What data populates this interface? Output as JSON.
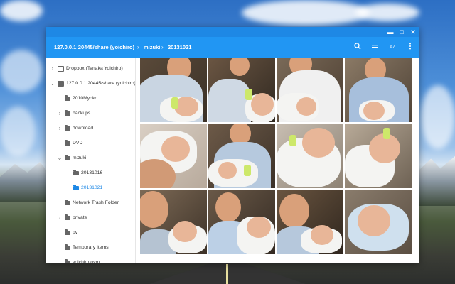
{
  "window": {
    "controls": {
      "minimize": "▬",
      "maximize": "□",
      "close": "✕"
    }
  },
  "breadcrumb": {
    "items": [
      "127.0.0.1:20445/share (yoichiro)",
      "mizuki",
      "20131021"
    ],
    "separator": "›"
  },
  "toolbar": {
    "search_icon": "search-icon",
    "view_icon": "list-view-icon",
    "sort_label": "AZ",
    "menu_icon": "more-vert-icon"
  },
  "sidebar": {
    "items": [
      {
        "label": "Dropbox (Tanaka Yoichiro)",
        "icon": "network-drive-icon",
        "expander": "›",
        "selected": false
      },
      {
        "label": "127.0.0.1:20445/share (yoichiro)",
        "icon": "drive-icon",
        "expander": "⌄",
        "selected": false
      },
      {
        "label": "2010Myoko",
        "icon": "folder-icon",
        "expander": "",
        "selected": false
      },
      {
        "label": "backups",
        "icon": "folder-icon",
        "expander": "›",
        "selected": false
      },
      {
        "label": "download",
        "icon": "folder-icon",
        "expander": "›",
        "selected": false
      },
      {
        "label": "DVD",
        "icon": "folder-icon",
        "expander": "",
        "selected": false
      },
      {
        "label": "mizuki",
        "icon": "folder-icon",
        "expander": "⌄",
        "selected": false
      },
      {
        "label": "20131016",
        "icon": "folder-icon",
        "expander": "",
        "selected": false
      },
      {
        "label": "20131021",
        "icon": "folder-icon",
        "expander": "",
        "selected": true
      },
      {
        "label": "Network Trash Folder",
        "icon": "folder-icon",
        "expander": "",
        "selected": false
      },
      {
        "label": "private",
        "icon": "folder-icon",
        "expander": "›",
        "selected": false
      },
      {
        "label": "pv",
        "icon": "folder-icon",
        "expander": "",
        "selected": false
      },
      {
        "label": "Temporary Items",
        "icon": "folder-icon",
        "expander": "",
        "selected": false
      },
      {
        "label": "yoichiro.gym",
        "icon": "folder-icon",
        "expander": "",
        "selected": false
      }
    ]
  },
  "colors": {
    "accent": "#2196f3",
    "titlebar": "#1e88e5",
    "selected": "#1e88e5"
  }
}
